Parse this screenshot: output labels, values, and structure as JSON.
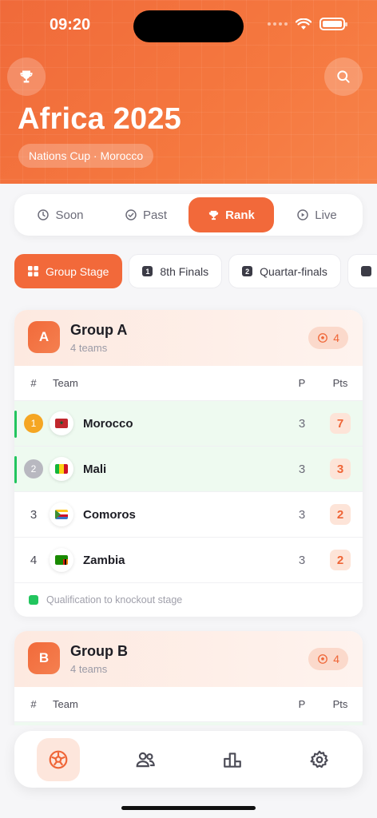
{
  "status": {
    "time": "09:20"
  },
  "header": {
    "title": "Africa 2025",
    "subtitle": "Nations Cup · Morocco",
    "left_icon": "trophy-icon",
    "right_icon": "search-icon"
  },
  "tabs": [
    {
      "label": "Soon",
      "icon": "clock-icon",
      "active": false
    },
    {
      "label": "Past",
      "icon": "check-circle-icon",
      "active": false
    },
    {
      "label": "Rank",
      "icon": "trophy-icon",
      "active": true
    },
    {
      "label": "Live",
      "icon": "play-circle-icon",
      "active": false
    }
  ],
  "stages": [
    {
      "label": "Group Stage",
      "badge": "",
      "active": true
    },
    {
      "label": "8th Finals",
      "badge": "1",
      "active": false
    },
    {
      "label": "Quartar-finals",
      "badge": "2",
      "active": false
    }
  ],
  "table_headers": {
    "pos": "#",
    "team": "Team",
    "played": "P",
    "points": "Pts"
  },
  "groups": [
    {
      "letter": "A",
      "title": "Group A",
      "teams_count": "4 teams",
      "matches": "4",
      "rows": [
        {
          "pos": "1",
          "team": "Morocco",
          "p": "3",
          "pts": "7",
          "qualified": true,
          "medal": "#f5a623"
        },
        {
          "pos": "2",
          "team": "Mali",
          "p": "3",
          "pts": "3",
          "qualified": true,
          "medal": "#b8b8c0"
        },
        {
          "pos": "3",
          "team": "Comoros",
          "p": "3",
          "pts": "2",
          "qualified": false
        },
        {
          "pos": "4",
          "team": "Zambia",
          "p": "3",
          "pts": "2",
          "qualified": false
        }
      ],
      "legend": "Qualification to knockout stage"
    },
    {
      "letter": "B",
      "title": "Group B",
      "teams_count": "4 teams",
      "matches": "4"
    }
  ],
  "bottom_nav": [
    {
      "icon": "soccer-ball-icon",
      "active": true
    },
    {
      "icon": "users-icon",
      "active": false
    },
    {
      "icon": "podium-icon",
      "active": false
    },
    {
      "icon": "settings-gear-icon",
      "active": false
    }
  ],
  "colors": {
    "accent": "#f2693a",
    "qualified": "#22c55e",
    "points_text": "#ef6536"
  }
}
